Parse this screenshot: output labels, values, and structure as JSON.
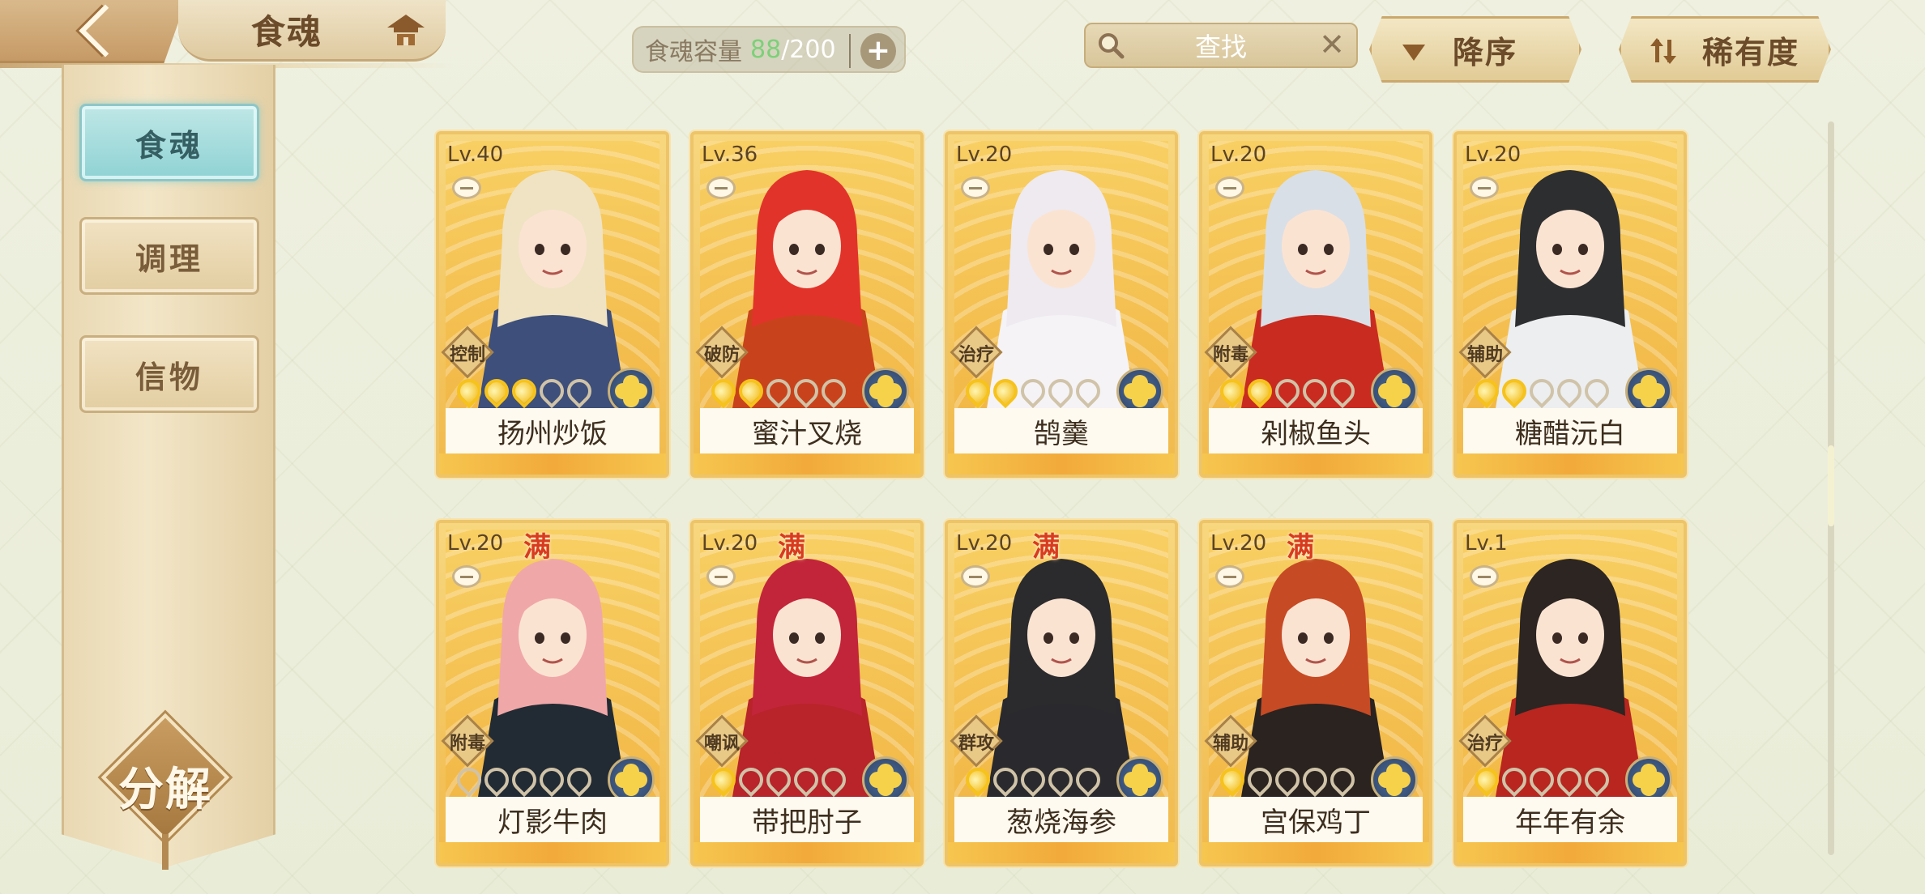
{
  "header": {
    "title": "食魂",
    "capacity_label": "食魂容量",
    "capacity_current": "88",
    "capacity_sep": "/",
    "capacity_max": "200",
    "capacity_plus": "+",
    "search_label": "查找",
    "search_clear": "✕",
    "sort_order_label": "降序",
    "sort_key_label": "稀有度"
  },
  "sidebar": {
    "tabs": [
      {
        "label": "食魂",
        "active": true
      },
      {
        "label": "调理",
        "active": false
      },
      {
        "label": "信物",
        "active": false
      }
    ],
    "decompose_label": "分解"
  },
  "colors": {
    "active_tab": "#8fd2d4",
    "card_gold": "#f1b94a",
    "full_badge": "#d83b20",
    "star_on": "#f6c21c"
  },
  "cards": [
    {
      "level": "Lv.40",
      "full": false,
      "full_label": "",
      "role": "控制",
      "stars": 3,
      "name": "扬州炒饭",
      "hair": "#efe3c4",
      "outfit": "#3d4f7a"
    },
    {
      "level": "Lv.36",
      "full": false,
      "full_label": "",
      "role": "破防",
      "stars": 2,
      "name": "蜜汁叉烧",
      "hair": "#e2332a",
      "outfit": "#c8431c"
    },
    {
      "level": "Lv.20",
      "full": false,
      "full_label": "",
      "role": "治疗",
      "stars": 2,
      "name": "鹄羹",
      "hair": "#eeeaf0",
      "outfit": "#f5f3f6"
    },
    {
      "level": "Lv.20",
      "full": false,
      "full_label": "",
      "role": "附毒",
      "stars": 2,
      "name": "剁椒鱼头",
      "hair": "#d9dfe6",
      "outfit": "#c92b20"
    },
    {
      "level": "Lv.20",
      "full": false,
      "full_label": "",
      "role": "辅助",
      "stars": 2,
      "name": "糖醋沅白",
      "hair": "#2d2e30",
      "outfit": "#eceef0"
    },
    {
      "level": "Lv.20",
      "full": true,
      "full_label": "满",
      "role": "附毒",
      "stars": 0,
      "name": "灯影牛肉",
      "hair": "#f0a7a8",
      "outfit": "#222b34"
    },
    {
      "level": "Lv.20",
      "full": true,
      "full_label": "满",
      "role": "嘲讽",
      "stars": 1,
      "name": "带把肘子",
      "hair": "#c2253a",
      "outfit": "#b8242a"
    },
    {
      "level": "Lv.20",
      "full": true,
      "full_label": "满",
      "role": "群攻",
      "stars": 1,
      "name": "葱烧海参",
      "hair": "#2b2b2d",
      "outfit": "#2a2a2e"
    },
    {
      "level": "Lv.20",
      "full": true,
      "full_label": "满",
      "role": "辅助",
      "stars": 1,
      "name": "宫保鸡丁",
      "hair": "#c64a24",
      "outfit": "#2a2320"
    },
    {
      "level": "Lv.1",
      "full": false,
      "full_label": "",
      "role": "治疗",
      "stars": 1,
      "name": "年年有余",
      "hair": "#2c2522",
      "outfit": "#b8261f"
    }
  ]
}
